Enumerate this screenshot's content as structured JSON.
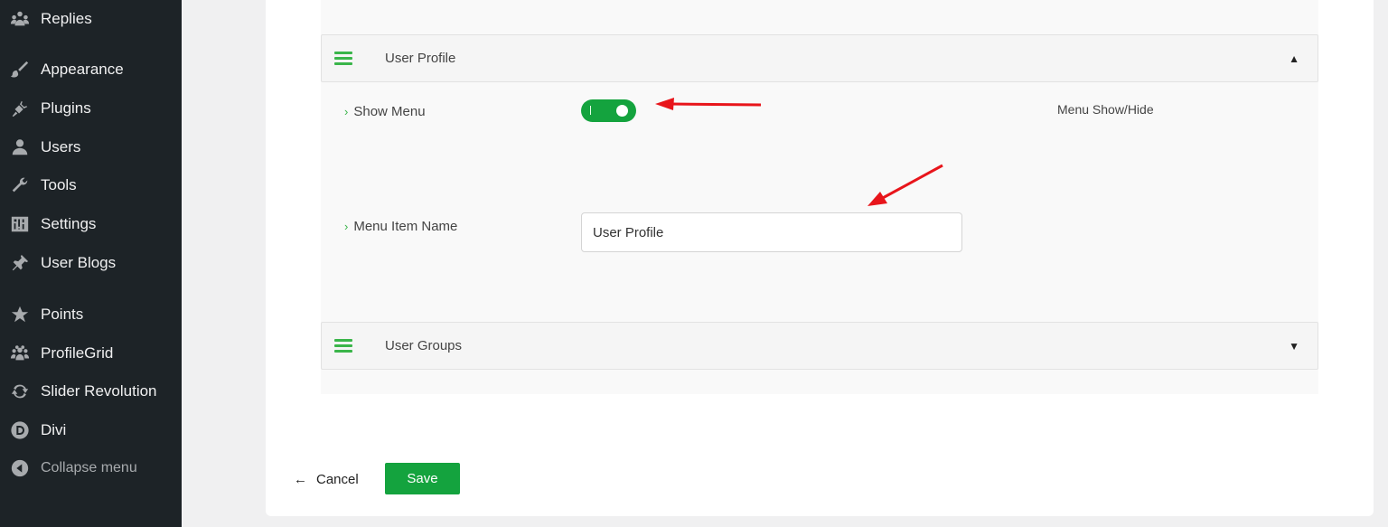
{
  "sidebar": {
    "items": [
      {
        "label": "Replies",
        "icon": "replies-icon"
      },
      {
        "label": "Appearance",
        "icon": "brush-icon"
      },
      {
        "label": "Plugins",
        "icon": "plug-icon"
      },
      {
        "label": "Users",
        "icon": "user-icon"
      },
      {
        "label": "Tools",
        "icon": "wrench-icon"
      },
      {
        "label": "Settings",
        "icon": "settings-icon"
      },
      {
        "label": "User Blogs",
        "icon": "pin-icon"
      },
      {
        "label": "Points",
        "icon": "star-icon"
      },
      {
        "label": "ProfileGrid",
        "icon": "group-icon"
      },
      {
        "label": "Slider Revolution",
        "icon": "refresh-icon"
      },
      {
        "label": "Divi",
        "icon": "divi-icon"
      }
    ],
    "collapse_label": "Collapse menu"
  },
  "sections": {
    "user_profile": {
      "title": "User Profile",
      "caret": "▲",
      "expanded": true
    },
    "user_groups": {
      "title": "User Groups",
      "caret": "▼",
      "expanded": false
    }
  },
  "fields": {
    "show_menu": {
      "label": "Show Menu",
      "enabled": true,
      "help": "Menu Show/Hide"
    },
    "menu_item_name": {
      "label": "Menu Item Name",
      "value": "User Profile"
    }
  },
  "actions": {
    "cancel_label": "Cancel",
    "save_label": "Save"
  },
  "colors": {
    "sidebar_bg": "#1d2327",
    "accent_green": "#14a33e",
    "annotation_red": "#e8151b"
  }
}
